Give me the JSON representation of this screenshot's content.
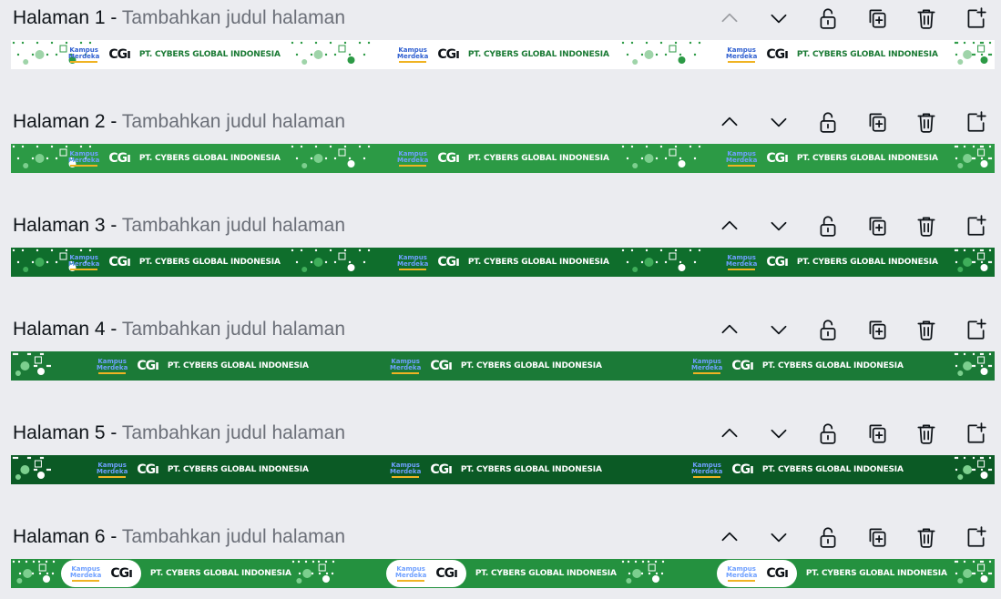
{
  "page_title_placeholder": "Tambahkan judul halaman",
  "separator": "-",
  "pages": [
    {
      "number": "Halaman 1",
      "banner_bg": "#ffffff",
      "text_color": "#1a7a34",
      "style": "light",
      "move_up_disabled": true
    },
    {
      "number": "Halaman 2",
      "banner_bg": "#2c9a45",
      "text_color": "#ffffff",
      "style": "mid",
      "move_up_disabled": false
    },
    {
      "number": "Halaman 3",
      "banner_bg": "#0f6e2c",
      "text_color": "#ffffff",
      "style": "dark",
      "move_up_disabled": false
    },
    {
      "number": "Halaman 4",
      "banner_bg": "#1b7a37",
      "text_color": "#ffffff",
      "style": "wide",
      "move_up_disabled": false
    },
    {
      "number": "Halaman 5",
      "banner_bg": "#0b5a25",
      "text_color": "#ffffff",
      "style": "wide",
      "move_up_disabled": false
    },
    {
      "number": "Halaman 6",
      "banner_bg": "#24913f",
      "text_color": "#ffffff",
      "style": "pill",
      "move_up_disabled": false
    }
  ],
  "banner": {
    "company_name": "PT. CYBERS GLOBAL INDONESIA",
    "logo_kampus_top": "Kampus",
    "logo_kampus_bottom": "Merdeka",
    "logo_cg": "CGı"
  },
  "controls": {
    "icons": [
      "chevron-up-icon",
      "chevron-down-icon",
      "lock-icon",
      "duplicate-icon",
      "trash-icon",
      "add-page-icon"
    ]
  },
  "colors": {
    "background": "#ebecf0",
    "text": "#0e1318",
    "placeholder": "#6b6f78",
    "icon": "#0e1318"
  }
}
